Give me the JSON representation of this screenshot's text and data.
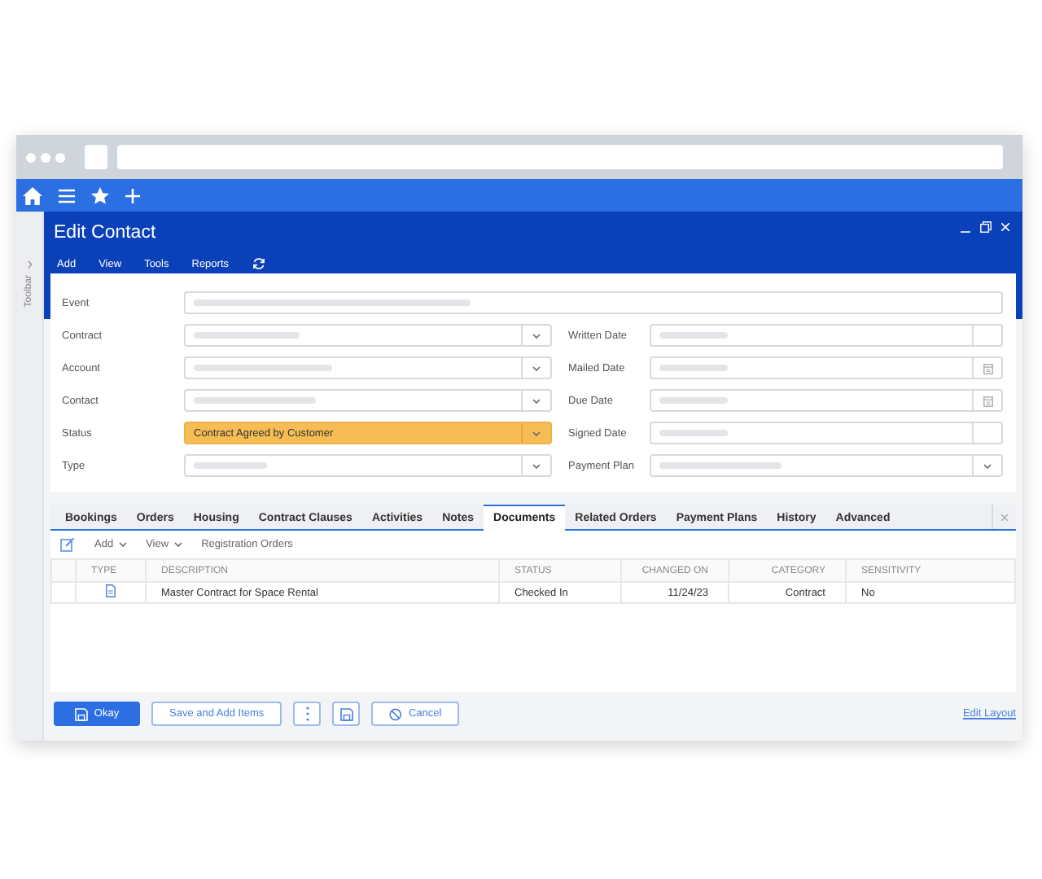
{
  "toolbar_strip": {
    "label": "Toolbar"
  },
  "window": {
    "title": "Edit Contact",
    "menu": [
      "Add",
      "View",
      "Tools",
      "Reports"
    ]
  },
  "form": {
    "left": [
      {
        "label": "Event",
        "kind": "wide"
      },
      {
        "label": "Contract",
        "kind": "dropdown"
      },
      {
        "label": "Account",
        "kind": "dropdown"
      },
      {
        "label": "Contact",
        "kind": "dropdown"
      },
      {
        "label": "Status",
        "kind": "dropdown",
        "value": "Contract Agreed by Customer",
        "highlighted": true
      },
      {
        "label": "Type",
        "kind": "dropdown"
      }
    ],
    "right": [
      {
        "label": "Written Date",
        "kind": "blank"
      },
      {
        "label": "Mailed Date",
        "kind": "calendar"
      },
      {
        "label": "Due Date",
        "kind": "calendar"
      },
      {
        "label": "Signed Date",
        "kind": "blank"
      },
      {
        "label": "Payment Plan",
        "kind": "dropdown"
      }
    ]
  },
  "tabs": [
    {
      "label": "Bookings",
      "selected": false
    },
    {
      "label": "Orders",
      "selected": false
    },
    {
      "label": "Housing",
      "selected": false
    },
    {
      "label": "Contract Clauses",
      "selected": false
    },
    {
      "label": "Activities",
      "selected": false
    },
    {
      "label": "Notes",
      "selected": false
    },
    {
      "label": "Documents",
      "selected": true
    },
    {
      "label": "Related Orders",
      "selected": false
    },
    {
      "label": "Payment Plans",
      "selected": false
    },
    {
      "label": "History",
      "selected": false
    },
    {
      "label": "Advanced",
      "selected": false
    }
  ],
  "grid_toolbar": [
    {
      "label": "Add",
      "kind": "menu"
    },
    {
      "label": "View",
      "kind": "menu"
    },
    {
      "label": "Registration Orders",
      "kind": "link"
    }
  ],
  "table": {
    "columns": [
      "TYPE",
      "DESCRIPTION",
      "STATUS",
      "CHANGED ON",
      "CATEGORY",
      "SENSITIVITY"
    ],
    "rows": [
      {
        "description": "Master Contract for Space Rental",
        "status": "Checked In",
        "changed_on": "11/24/23",
        "category": "Contract",
        "sensitivity": "No"
      }
    ]
  },
  "footer": {
    "buttons": [
      {
        "label": "Okay",
        "kind": "primary"
      },
      {
        "label": "Save and Add Items",
        "kind": "outline"
      },
      {
        "kind": "more"
      },
      {
        "kind": "save"
      },
      {
        "label": "Cancel",
        "kind": "cancel"
      }
    ],
    "link": "Edit Layout"
  }
}
